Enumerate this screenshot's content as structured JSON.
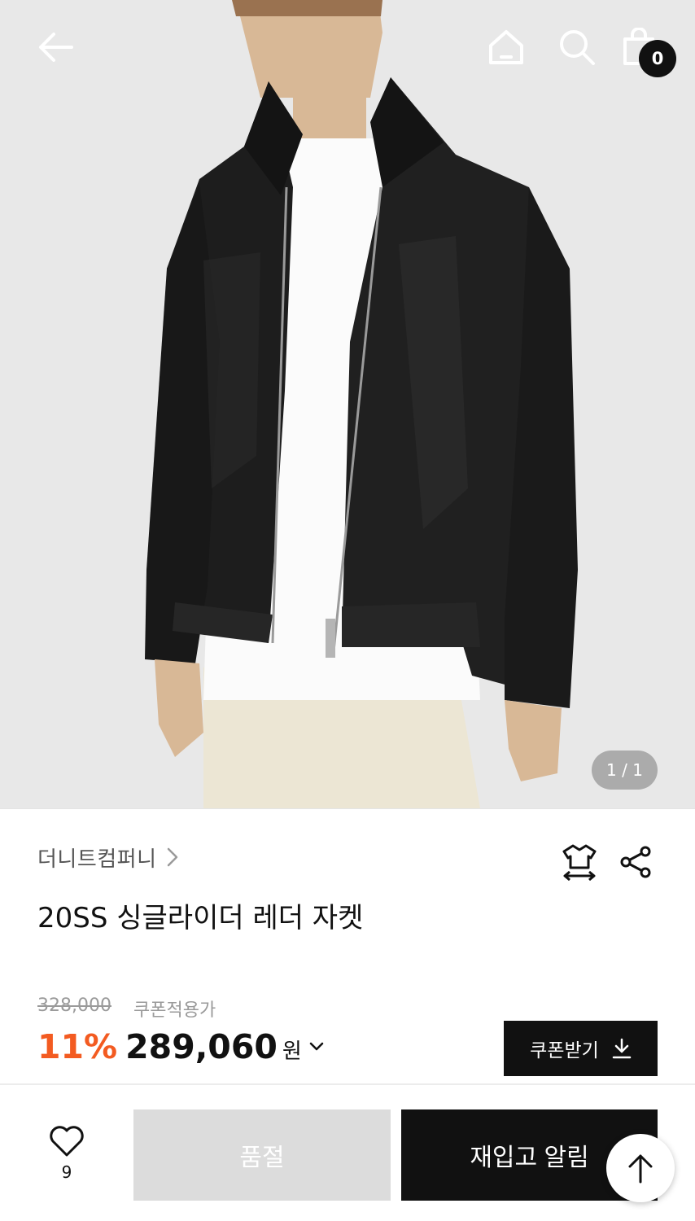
{
  "header": {
    "back_icon": "arrow-left-icon",
    "home_icon": "home-icon",
    "search_icon": "search-icon",
    "cart_icon": "shopping-bag-icon",
    "cart_count": "0"
  },
  "gallery": {
    "image_subject": "model-in-black-leather-jacket",
    "page_indicator": "1 / 1"
  },
  "product": {
    "brand": "더니트컴퍼니",
    "title": "20SS 싱글라이더 레더 자켓",
    "size_icon": "size-guide-icon",
    "share_icon": "share-icon"
  },
  "price": {
    "original": "328,000",
    "coupon_label": "쿠폰적용가",
    "discount": "11%",
    "final": "289,060",
    "currency": "원",
    "discount_color": "#f35b21"
  },
  "coupon_button": {
    "label": "쿠폰받기",
    "icon": "download-icon"
  },
  "bottom_bar": {
    "like_icon": "heart-icon",
    "like_count": "9",
    "soldout_label": "품절",
    "restock_label": "재입고 알림",
    "scroll_top_icon": "arrow-up-icon"
  }
}
